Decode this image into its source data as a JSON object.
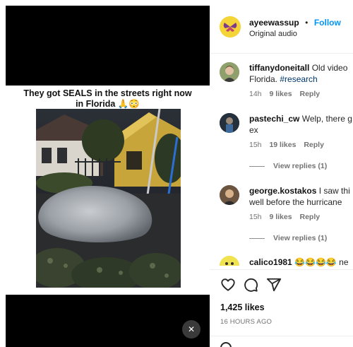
{
  "post": {
    "caption": "They got SEALS in the streets right now in Florida 🙏😳",
    "caption_line1": "They got SEALS in the streets right now",
    "caption_line2": "in Florida 🙏😳",
    "mute_icon": "close-icon"
  },
  "header": {
    "username": "ayeewassup",
    "separator": "•",
    "follow_label": "Follow",
    "audio": "Original audio"
  },
  "comments": [
    {
      "username": "tiffanydoneitall",
      "text_line1": "Old video",
      "text_line2_pre": "Florida. ",
      "hashtag": "#research",
      "time": "14h",
      "likes": "9 likes",
      "reply": "Reply"
    },
    {
      "username": "pastechi_cw",
      "text_line1": "Welp, there g",
      "text_line2": "ex",
      "time": "15h",
      "likes": "19 likes",
      "reply": "Reply",
      "view_replies": "View replies (1)"
    },
    {
      "username": "george.kostakos",
      "text_line1": "I saw thi",
      "text_line2": "well before the hurricane",
      "time": "15h",
      "likes": "9 likes",
      "reply": "Reply",
      "view_replies": "View replies (1)"
    },
    {
      "username": "calico1981",
      "text_line1": "😂😂😂😂 ne"
    }
  ],
  "actions": {
    "like_icon": "heart-icon",
    "comment_icon": "comment-icon",
    "share_icon": "share-icon"
  },
  "stats": {
    "likes": "1,425 likes",
    "posted": "16 HOURS AGO"
  },
  "colors": {
    "accent": "#0095f6",
    "hashtag": "#00376b",
    "muted": "#737373"
  }
}
